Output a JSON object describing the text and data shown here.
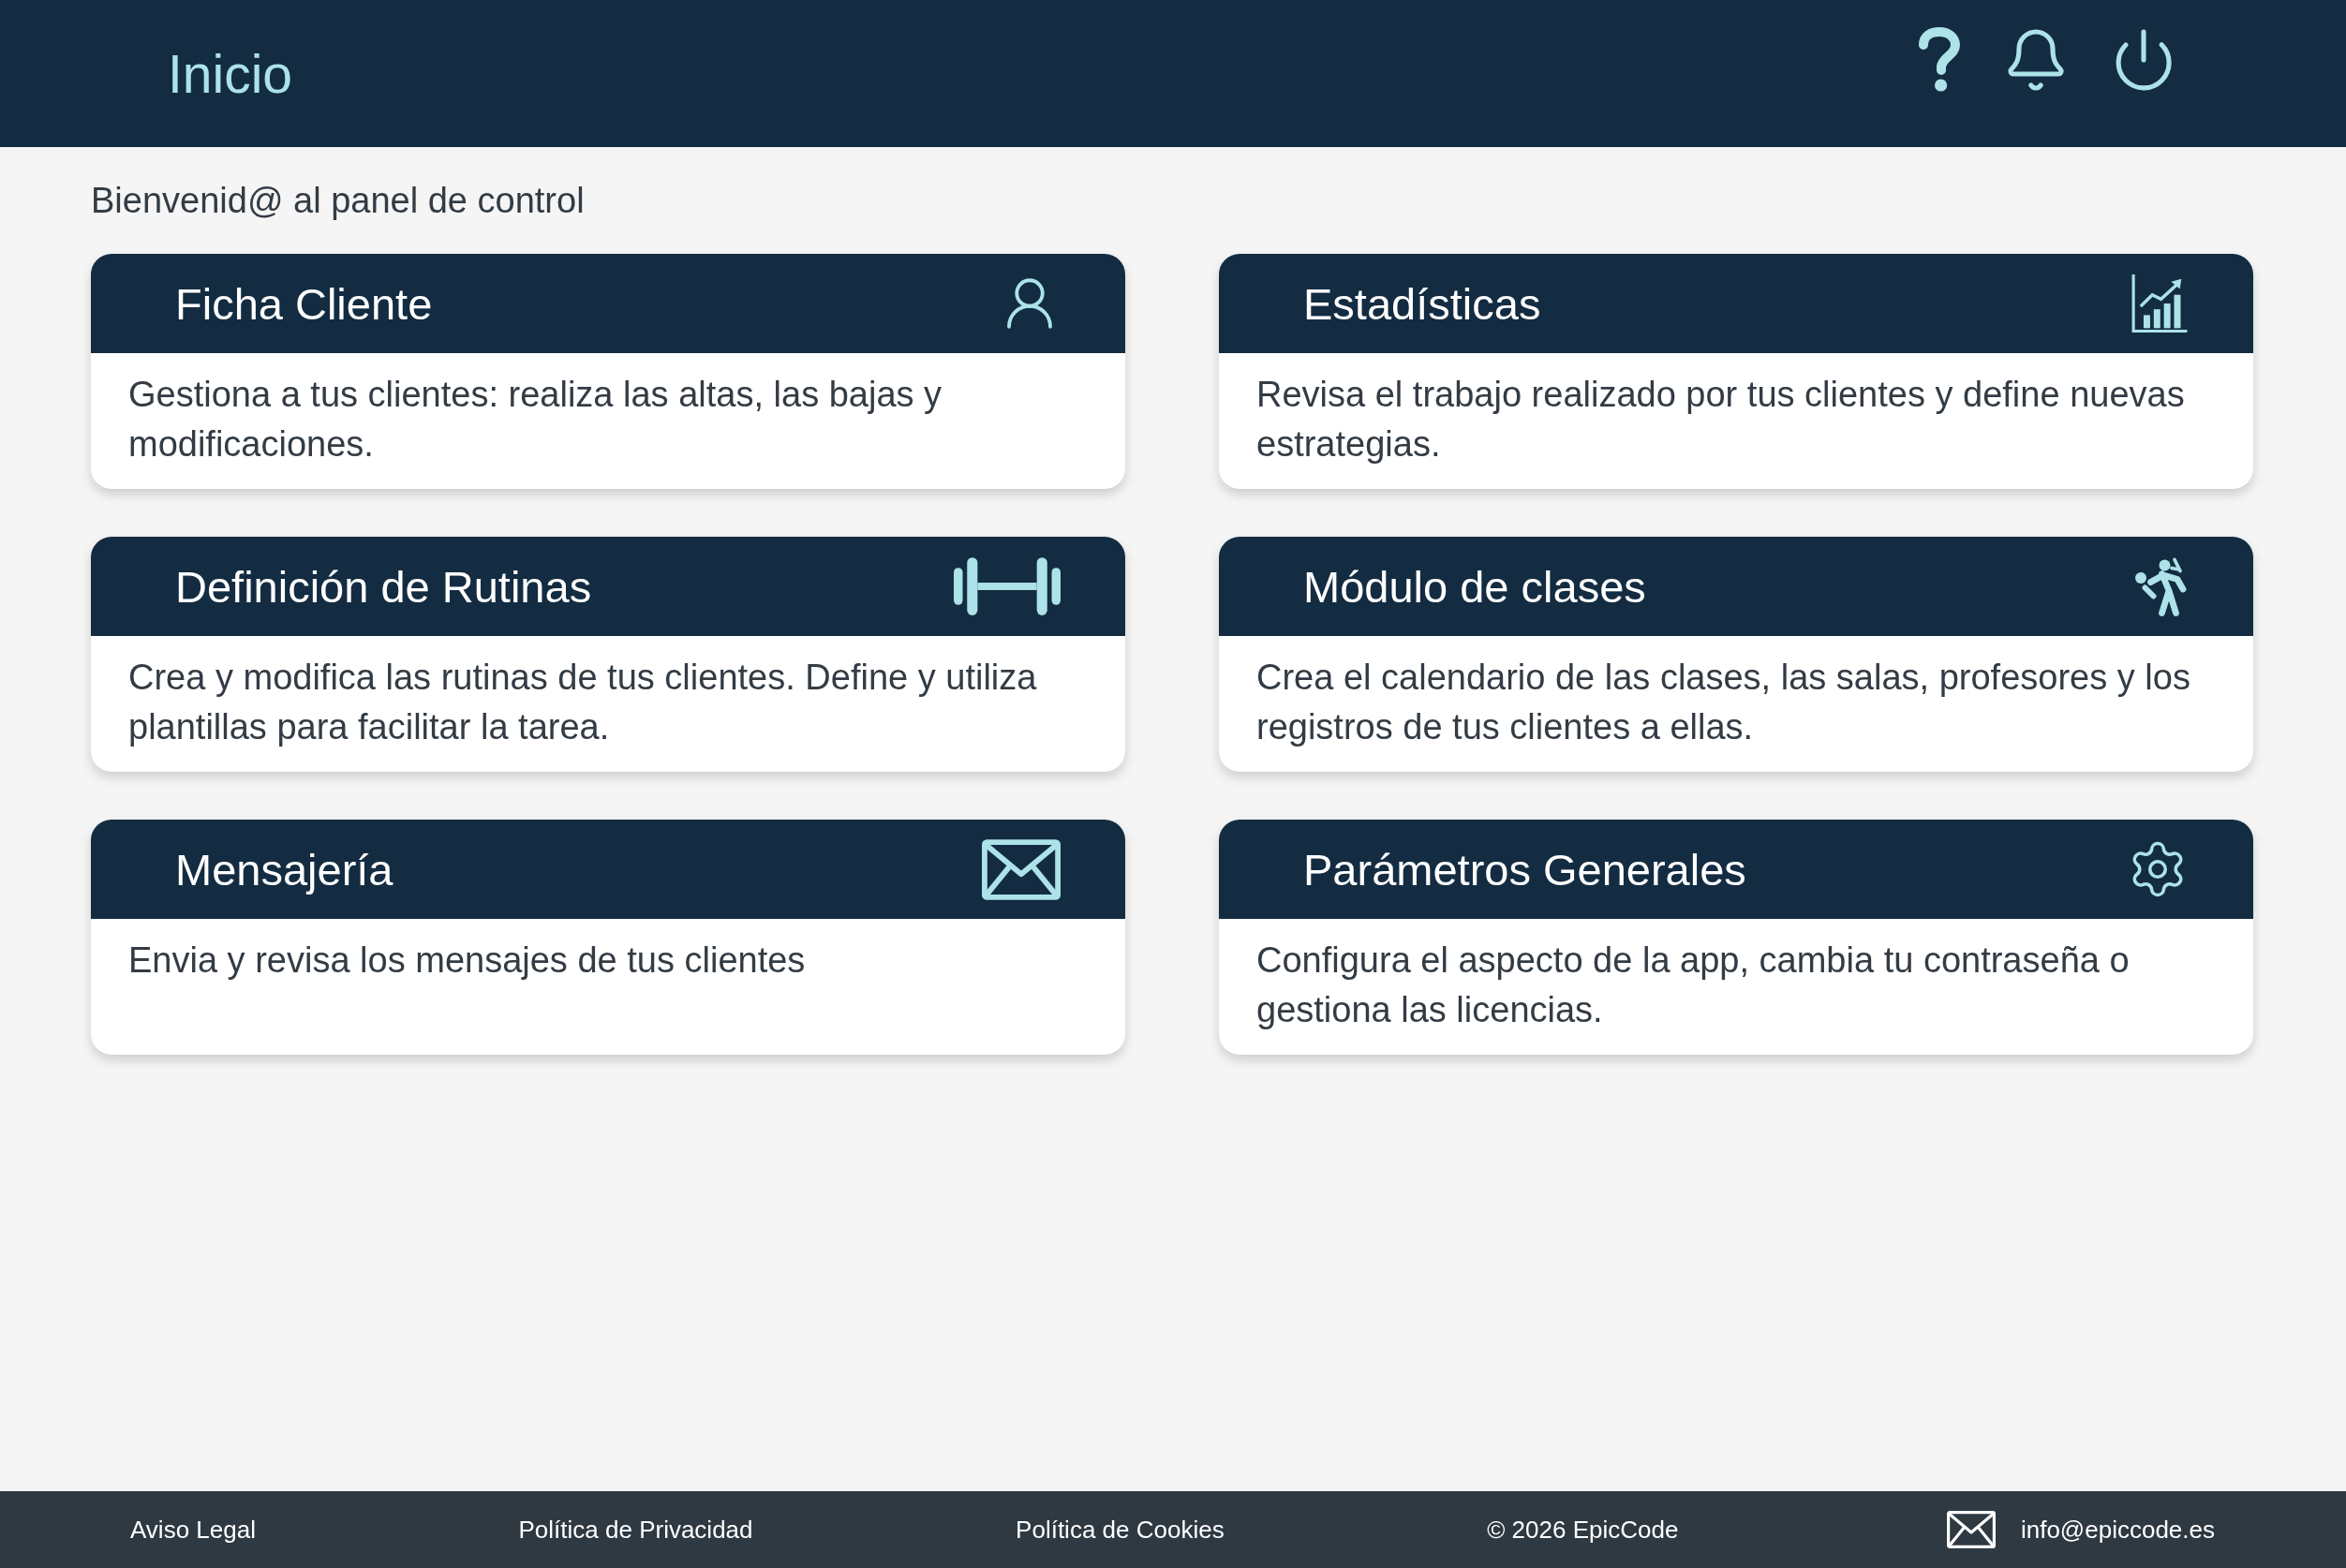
{
  "header": {
    "title": "Inicio"
  },
  "welcome": "Bienvenid@ al panel de control",
  "cards": [
    {
      "kind": "user",
      "title": "Ficha Cliente",
      "description": "Gestiona a tus clientes: realiza las altas, las bajas y modificaciones."
    },
    {
      "kind": "stats",
      "title": "Estadísticas",
      "description": "Revisa el trabajo realizado por tus clientes y define nuevas estrategias."
    },
    {
      "kind": "barbell",
      "title": "Definición de Rutinas",
      "description": "Crea y modifica las rutinas de tus clientes. Define y utiliza plantillas para facilitar la tarea."
    },
    {
      "kind": "classes",
      "title": "Módulo de clases",
      "description": "Crea el calendario de las clases, las salas, profesores y los registros de tus clientes a ellas."
    },
    {
      "kind": "mail",
      "title": "Mensajería",
      "description": "Envia y revisa los mensajes de tus clientes"
    },
    {
      "kind": "settings",
      "title": "Parámetros Generales",
      "description": "Configura el aspecto de la app, cambia tu contraseña o gestiona las licencias."
    }
  ],
  "footer": {
    "links": [
      "Aviso Legal",
      "Política de Privacidad",
      "Política de Cookies"
    ],
    "copyright": "© 2026 EpicCode",
    "email": "info@epiccode.es"
  }
}
